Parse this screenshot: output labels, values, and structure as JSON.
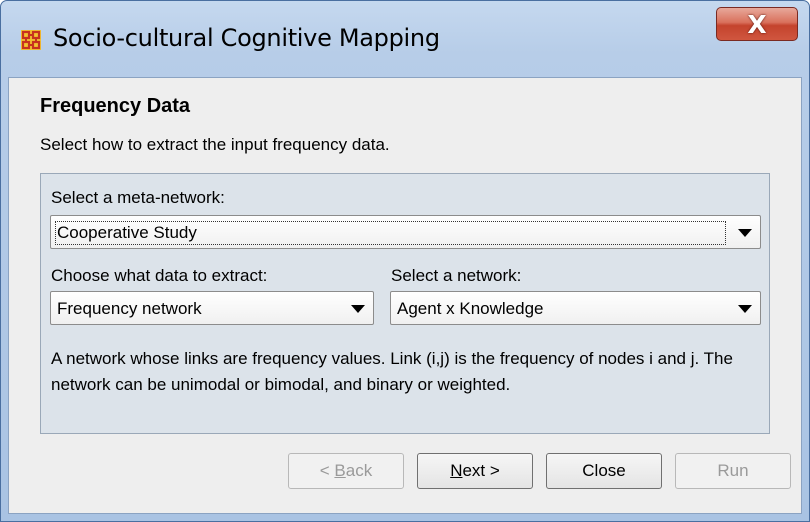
{
  "window": {
    "title": "Socio-cultural Cognitive Mapping",
    "close_glyph": "X",
    "icon": "ora-app-icon",
    "accent": "#4a6fa0"
  },
  "page": {
    "heading": "Frequency Data",
    "subheading": "Select how to extract the input frequency data."
  },
  "form": {
    "meta_network_label": "Select a meta-network:",
    "meta_network_value": "Cooperative Study",
    "extract_label": "Choose what data to extract:",
    "extract_value": "Frequency network",
    "network_label": "Select a network:",
    "network_value": "Agent x Knowledge",
    "description": "A network whose links are frequency values. Link (i,j) is the frequency of nodes i and j. The network can be unimodal or bimodal, and binary or weighted."
  },
  "buttons": {
    "back": {
      "prefix": "< ",
      "mnemonic": "B",
      "rest": "ack",
      "enabled": false
    },
    "next": {
      "prefix": "",
      "mnemonic": "N",
      "rest": "ext >",
      "enabled": true
    },
    "close": {
      "label": "Close",
      "enabled": true
    },
    "run": {
      "label": "Run",
      "enabled": false
    }
  }
}
